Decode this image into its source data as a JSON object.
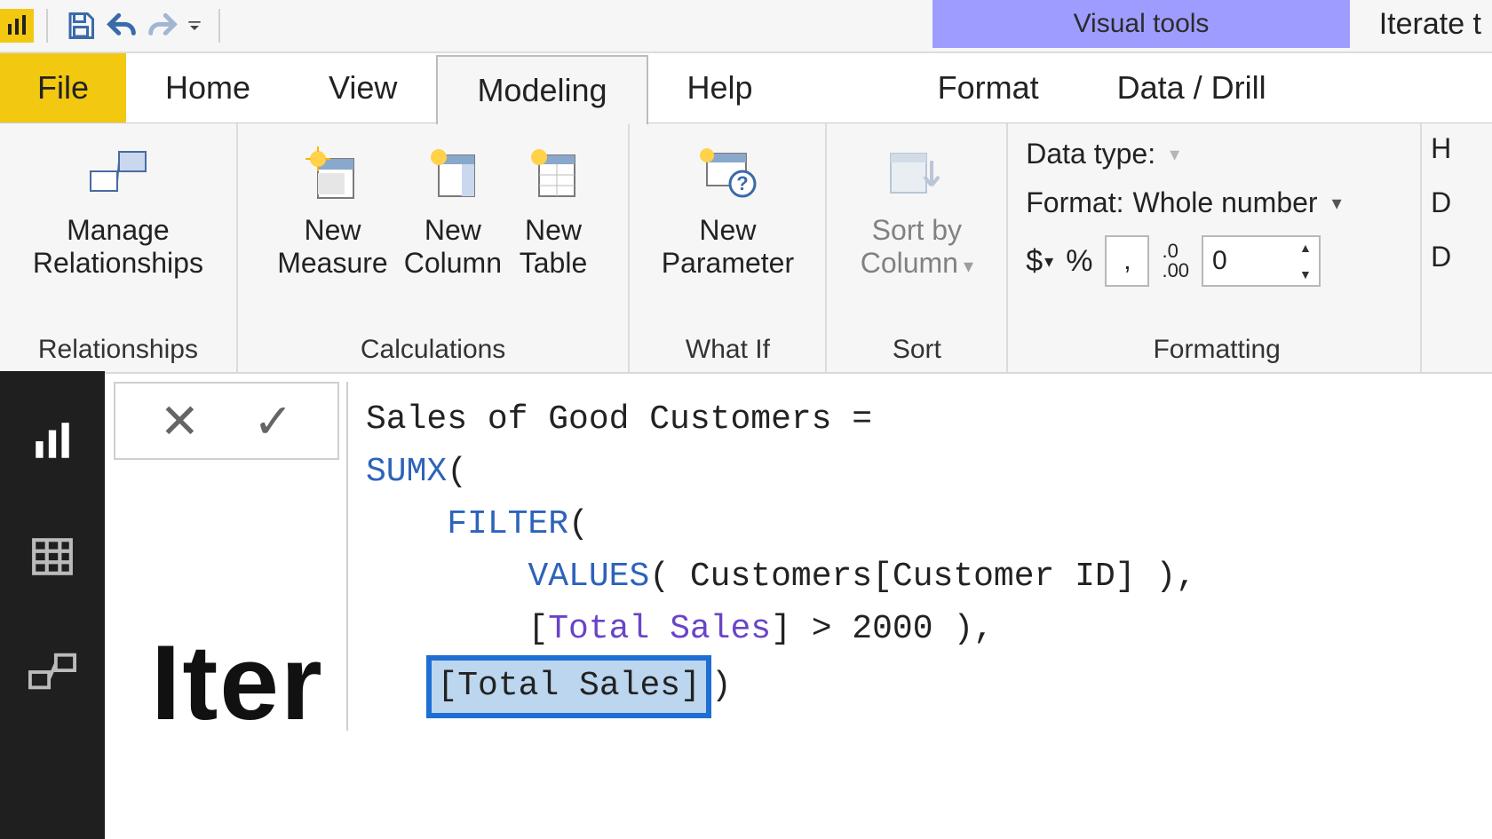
{
  "titlebar": {
    "contextual_tab": "Visual tools",
    "right_text": "Iterate t"
  },
  "tabs": {
    "file": "File",
    "home": "Home",
    "view": "View",
    "modeling": "Modeling",
    "help": "Help",
    "format": "Format",
    "data_drill": "Data / Drill"
  },
  "ribbon": {
    "relationships": {
      "manage": "Manage\nRelationships",
      "group": "Relationships"
    },
    "calculations": {
      "new_measure": "New\nMeasure",
      "new_column": "New\nColumn",
      "new_table": "New\nTable",
      "group": "Calculations"
    },
    "whatif": {
      "new_parameter": "New\nParameter",
      "group": "What If"
    },
    "sort": {
      "sort_by_column": "Sort by\nColumn",
      "group": "Sort"
    },
    "formatting": {
      "data_type_label": "Data type:",
      "format_label": "Format:",
      "format_value": "Whole number",
      "currency": "$",
      "percent": "%",
      "thousands": ",",
      "decimal_icon": ".0\n.00",
      "decimals_value": "0",
      "group": "Formatting",
      "right_h": "H",
      "right_d1": "D",
      "right_d2": "D"
    }
  },
  "formula": {
    "line1_a": "Sales of Good Customers = ",
    "line2_kw": "SUMX",
    "line2_a": "(",
    "line3_kw": "FILTER",
    "line3_a": "(",
    "line4_kw": "VALUES",
    "line4_a": "( Customers[Customer ID] ),",
    "line5_a": "[",
    "line5_ref": "Total Sales",
    "line5_b": "] > 2000 ),",
    "line6_sel": "[Total Sales]",
    "line6_tail": ")"
  },
  "canvas": {
    "peek_text": "Iter"
  }
}
